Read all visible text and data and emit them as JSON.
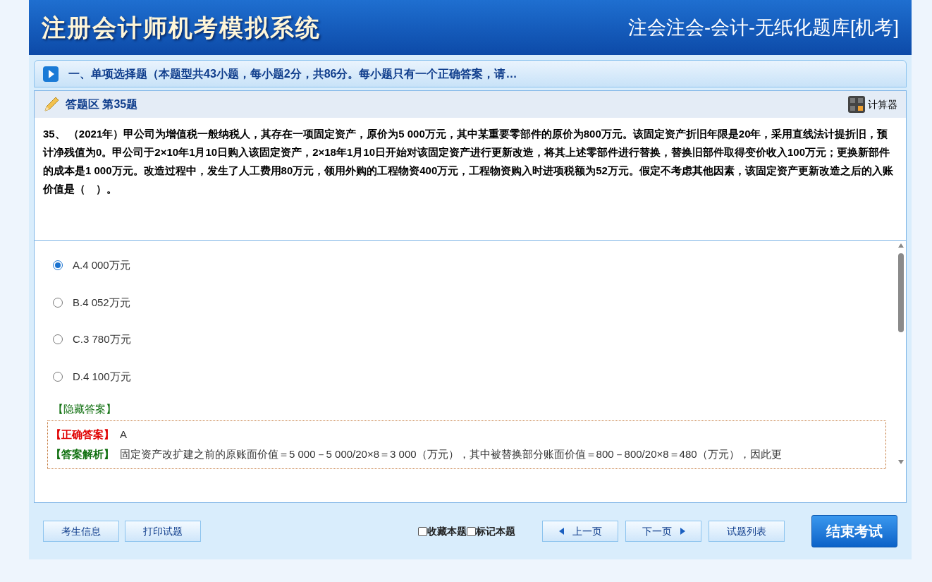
{
  "header": {
    "logo": "注册会计师机考模拟系统",
    "title": "注会注会-会计-无纸化题库[机考]"
  },
  "section": {
    "title": "一、单项选择题（本题型共43小题，每小题2分，共86分。每小题只有一个正确答案，请…"
  },
  "answer_area": {
    "title": "答题区 第35题",
    "calculator": "计算器"
  },
  "question": {
    "text": "35、 （2021年）甲公司为增值税一般纳税人，其存在一项固定资产，原价为5 000万元，其中某重要零部件的原价为800万元。该固定资产折旧年限是20年，采用直线法计提折旧，预计净残值为0。甲公司于2×10年1月10日购入该固定资产，2×18年1月10日开始对该固定资产进行更新改造，将其上述零部件进行替换，替换旧部件取得变价收入100万元；更换新部件的成本是1 000万元。改造过程中，发生了人工费用80万元，领用外购的工程物资400万元，工程物资购入时进项税额为52万元。假定不考虑其他因素，该固定资产更新改造之后的入账价值是（　）。"
  },
  "options": [
    {
      "label": "A.4 000万元",
      "selected": true
    },
    {
      "label": "B.4 052万元",
      "selected": false
    },
    {
      "label": "C.3 780万元",
      "selected": false
    },
    {
      "label": "D.4 100万元",
      "selected": false
    }
  ],
  "hide_answer": "【隐藏答案】",
  "answer": {
    "correct_label": "【正确答案】",
    "correct_value": "A",
    "analysis_label": "【答案解析】",
    "analysis_text": "固定资产改扩建之前的原账面价值＝5 000－5 000/20×8＝3 000（万元），其中被替换部分账面价值＝800－800/20×8＝480（万元），因此更"
  },
  "footer": {
    "left_buttons": [
      "考生信息",
      "打印试题"
    ],
    "checkboxes": [
      {
        "label": "收藏本题",
        "checked": false
      },
      {
        "label": "标记本题",
        "checked": false
      }
    ],
    "prev": "上一页",
    "next": "下一页",
    "list": "试题列表",
    "finish": "结束考试"
  }
}
